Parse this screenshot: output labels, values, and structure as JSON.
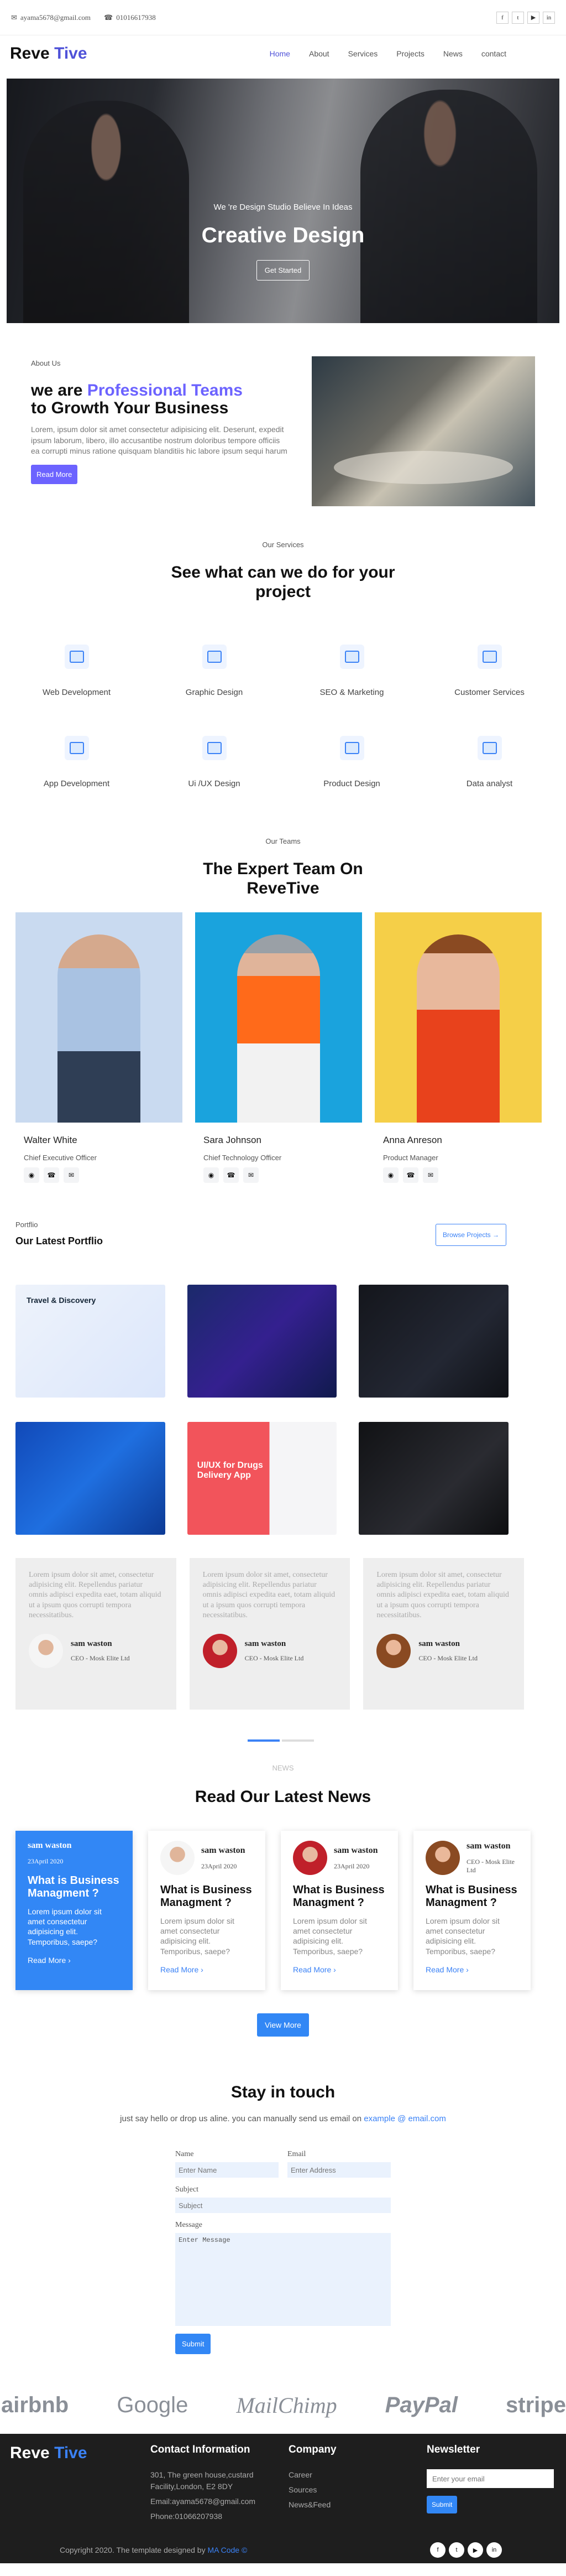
{
  "topbar": {
    "email": "ayama5678@gmail.com",
    "phone": "01016617938",
    "socials": [
      "facebook-icon",
      "twitter-icon",
      "youtube-icon",
      "linkedin-icon"
    ]
  },
  "nav": {
    "logo_a": "Reve",
    "logo_b": "Tive",
    "items": [
      {
        "label": "Home",
        "active": true
      },
      {
        "label": "About"
      },
      {
        "label": "Services"
      },
      {
        "label": "Projects"
      },
      {
        "label": "News"
      },
      {
        "label": "contact"
      }
    ]
  },
  "hero": {
    "subtitle": "We 're Design Studio Believe In Ideas",
    "title": "Creative Design",
    "button": "Get Started"
  },
  "about": {
    "label": "About Us",
    "title_a": "we are ",
    "title_accent": "Professional Teams",
    "title_b": "to Growth Your Business",
    "text": "Lorem, ipsum dolor sit amet consectetur adipisicing elit. Deserunt, expedit ipsum laborum, libero, illo accusantibe nostrum doloribus tempore officiis ea corrupti minus ratione quisquam blanditiis hic labore ipsum sequi harum",
    "button": "Read More"
  },
  "services": {
    "label": "Our Services",
    "title": "See what can we do for your project",
    "items": [
      "Web Development",
      "Graphic Design",
      "SEO & Marketing",
      "Customer Services",
      "App Development",
      "Ui /UX Design",
      "Product Design",
      "Data analyst"
    ]
  },
  "team": {
    "label": "Our Teams",
    "title": "The Expert Team On ReveTive",
    "members": [
      {
        "name": "Walter White",
        "role": "Chief Executive Officer"
      },
      {
        "name": "Sara Johnson",
        "role": "Chief Technology Officer"
      },
      {
        "name": "Anna Anreson",
        "role": "Product Manager"
      }
    ]
  },
  "portfolio": {
    "label": "Portflio",
    "title": "Our Latest Portflio",
    "button": "Browse Projects",
    "items": [
      "Travel & Discovery",
      "",
      "",
      "",
      "UI/UX for Drugs Delivery App",
      ""
    ]
  },
  "testimonials": [
    {
      "text": "Lorem ipsum dolor sit amet, consectetur adipisicing elit. Repellendus pariatur omnis adipisci expedita eaet, totam aliquid ut a ipsum quos corrupti tempora necessitatibus.",
      "name": "sam waston",
      "role": "CEO - Mosk Elite Ltd"
    },
    {
      "text": "Lorem ipsum dolor sit amet, consectetur adipisicing elit. Repellendus pariatur omnis adipisci expedita eaet, totam aliquid ut a ipsum quos corrupti tempora necessitatibus.",
      "name": "sam waston",
      "role": "CEO - Mosk Elite Ltd"
    },
    {
      "text": "Lorem ipsum dolor sit amet, consectetur adipisicing elit. Repellendus pariatur omnis adipisci expedita eaet, totam aliquid ut a ipsum quos corrupti tempora necessitatibus.",
      "name": "sam waston",
      "role": "CEO - Mosk Elite Ltd"
    }
  ],
  "news": {
    "label": "NEWS",
    "title": "Read Our Latest News",
    "button": "View More",
    "items": [
      {
        "author": "sam waston",
        "date": "23April 2020",
        "title": "What is Business Managment ?",
        "text": "Lorem ipsum dolor sit amet consectetur adipisicing elit. Temporibus, saepe?",
        "more": "Read More"
      },
      {
        "author": "sam waston",
        "date": "23April 2020",
        "title": "What is Business Managment ?",
        "text": "Lorem ipsum dolor sit amet consectetur adipisicing elit. Temporibus, saepe?",
        "more": "Read More"
      },
      {
        "author": "sam waston",
        "date": "23April 2020",
        "title": "What is Business Managment ?",
        "text": "Lorem ipsum dolor sit amet consectetur adipisicing elit. Temporibus, saepe?",
        "more": "Read More"
      },
      {
        "author": "sam waston",
        "date": "CEO - Mosk Elite Ltd",
        "title": "What is Business Managment ?",
        "text": "Lorem ipsum dolor sit amet consectetur adipisicing elit. Temporibus, saepe?",
        "more": "Read More"
      }
    ]
  },
  "contact": {
    "title": "Stay in touch",
    "intro": "just say hello or drop us aline. you can manually send us email on ",
    "intro_email": "example @ email.com",
    "name_label": "Name",
    "name_ph": "Enter Name",
    "email_label": "Email",
    "email_ph": "Enter Address",
    "subject_label": "Subject",
    "subject_ph": "Subject",
    "message_label": "Message",
    "message_ph": "Enter Message",
    "submit": "Submit"
  },
  "brands": [
    "airbnb",
    "Google",
    "MailChimp",
    "PayPal",
    "stripe"
  ],
  "footer": {
    "logo_a": "Reve",
    "logo_b": "Tive",
    "contact_title": "Contact Information",
    "address": "301, The green house,custard Facility,London, E2 8DY",
    "email": "Email:ayama5678@gmail.com",
    "phone": "Phone:01066207938",
    "company_title": "Company",
    "company_items": [
      "Career",
      "Sources",
      "News&Feed"
    ],
    "newsletter_title": "Newsletter",
    "newsletter_ph": "Enter your email",
    "newsletter_btn": "Submit",
    "copyright": "Copyright 2020. The template designed by ",
    "copyright_link": "MA Code ©"
  },
  "colors": {
    "accent": "#4f52d8",
    "purple": "#6c63ff",
    "blue": "#3287f5",
    "footer": "#1e1e1e"
  }
}
